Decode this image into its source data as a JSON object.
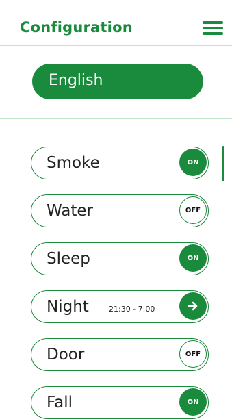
{
  "header": {
    "title": "Configuration"
  },
  "language": {
    "label": "English"
  },
  "settings": [
    {
      "label": "Smoke",
      "state": "ON"
    },
    {
      "label": "Water",
      "state": "OFF"
    },
    {
      "label": "Sleep",
      "state": "ON"
    },
    {
      "label": "Night",
      "sublabel": "21:30 - 7:00",
      "state": "arrow"
    },
    {
      "label": "Door",
      "state": "OFF"
    },
    {
      "label": "Fall",
      "state": "ON"
    }
  ],
  "colors": {
    "accent": "#1a8a3c",
    "divider": "#bfe6c8"
  }
}
